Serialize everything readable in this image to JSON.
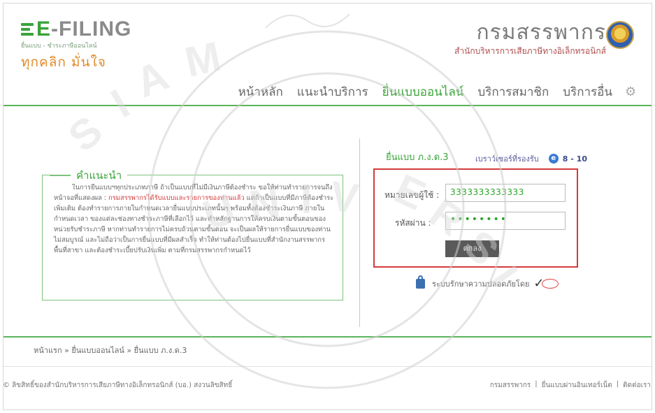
{
  "logo": {
    "title_prefix": "E",
    "title_rest": "-FILING",
    "subtitle": "ยื่นแบบ - ชำระภาษีออนไลน์",
    "tagline": "ทุกคลิก มั่นใจ"
  },
  "agency": {
    "name": "กรมสรรพากร",
    "sub": "สำนักบริหารการเสียภาษีทางอิเล็กทรอนิกส์"
  },
  "nav": {
    "items": [
      "หน้าหลัก",
      "แนะนำบริการ",
      "ยื่นแบบออนไลน์",
      "บริการสมาชิก",
      "บริการอื่น"
    ],
    "active_index": 2
  },
  "instructions": {
    "title": "คำแนะนำ",
    "text_1": "ในการยื่นแบบฯทุกประเภทภาษี ถ้าเป็นแบบที่ไม่มีเงินภาษีต้องชำระ ขอให้ท่านทำรายการจนถึงหน้าจอที่แสดงผล : ",
    "text_highlight": "กรมสรรพากรได้รับแบบและรายการของท่านแล้ว",
    "text_2": " แต่ถ้าเป็นแบบที่มีภาษีต้องชำระเพิ่มเติม ต้องทำรายการภายในกำหนดเวลายื่นแบบประเภทนั้นๆ พร้อมทั้งต้องชำระเงินภาษี ภายในกำหนดเวลา ของแต่ละช่องทางชำระภาษีที่เลือกไว้ และทำหลักฐานการให้ครบเงินตามขั้นตอนของหน่วยรับชำระภาษี หากท่านทำรายการไม่ครบถ้วนตามขั้นตอน จะเป็นผลให้รายการยื่นแบบของท่านไม่สมบูรณ์ และไม่ถือว่าเป็นการยื่นแบบที่มีผลสำเร็จ ทำให้ท่านต้องไปยื่นแบบที่สำนักงานสรรพากรพื้นที่สาขา และต้องชำระเบี้ยปรับเงินเพิ่ม ตามที่กรมสรรพากรกำหนดไว้"
  },
  "login": {
    "form_title": "ยื่นแบบ ภ.ง.ด.3",
    "browser_label": "เบราว์เซอร์ที่รองรับ",
    "browser_version": "8 - 10",
    "user_label": "หมายเลขผู้ใช้ :",
    "user_value": "3333333333333",
    "pass_label": "รหัสผ่าน :",
    "pass_value": "••••••••",
    "submit_label": "ตกลง",
    "secure_text": "ระบบรักษาความปลอดภัยโดย"
  },
  "breadcrumb": "หน้าแรก » ยื่นแบบออนไลน์ » ยื่นแบบ ภ.ง.ด.3",
  "footer": {
    "copyright": "© ลิขสิทธิ์ของสำนักบริหารการเสียภาษีทางอิเล็กทรอนิกส์ (บอ.) สงวนลิขสิทธิ์",
    "links": [
      "กรมสรรพากร",
      "ยื่นแบบผ่านอินเทอร์เน็ต",
      "ติดต่อเรา"
    ],
    "separator": "|"
  },
  "colors": {
    "accent_green": "#3aa33a",
    "highlight_red": "#d23b3b",
    "login_border": "#d43a3a",
    "button_gray": "#5a5a5a"
  },
  "icons": [
    "e-filing-logo-bars",
    "revenue-department-seal",
    "gear-icon",
    "ie-browser-icon",
    "lock-icon",
    "security-seal-icon"
  ]
}
